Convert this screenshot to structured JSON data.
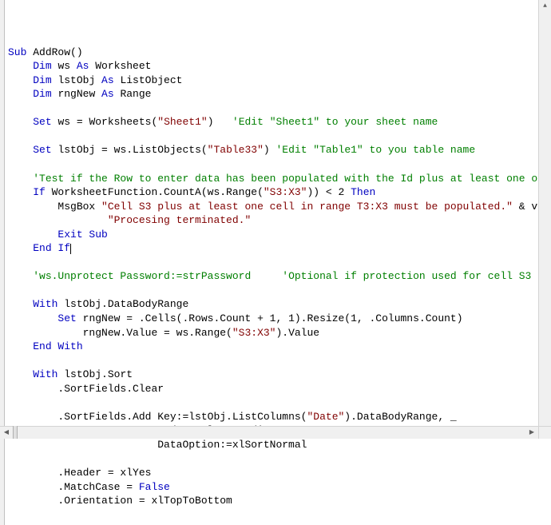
{
  "code": {
    "lines": [
      {
        "indent": 0,
        "segments": [
          [
            "kw",
            "Sub "
          ],
          [
            "id",
            "AddRow()"
          ]
        ]
      },
      {
        "indent": 1,
        "segments": [
          [
            "kw",
            "Dim "
          ],
          [
            "id",
            "ws "
          ],
          [
            "kw",
            "As "
          ],
          [
            "id",
            "Worksheet"
          ]
        ]
      },
      {
        "indent": 1,
        "segments": [
          [
            "kw",
            "Dim "
          ],
          [
            "id",
            "lstObj "
          ],
          [
            "kw",
            "As "
          ],
          [
            "id",
            "ListObject"
          ]
        ]
      },
      {
        "indent": 1,
        "segments": [
          [
            "kw",
            "Dim "
          ],
          [
            "id",
            "rngNew "
          ],
          [
            "kw",
            "As "
          ],
          [
            "id",
            "Range"
          ]
        ]
      },
      {
        "indent": 0,
        "segments": []
      },
      {
        "indent": 1,
        "segments": [
          [
            "kw",
            "Set "
          ],
          [
            "id",
            "ws = Worksheets("
          ],
          [
            "str",
            "\"Sheet1\""
          ],
          [
            "id",
            ")   "
          ],
          [
            "cmt",
            "'Edit \"Sheet1\" to your sheet name"
          ]
        ]
      },
      {
        "indent": 0,
        "segments": []
      },
      {
        "indent": 1,
        "segments": [
          [
            "kw",
            "Set "
          ],
          [
            "id",
            "lstObj = ws.ListObjects("
          ],
          [
            "str",
            "\"Table33\""
          ],
          [
            "id",
            ") "
          ],
          [
            "cmt",
            "'Edit \"Table1\" to you table name"
          ]
        ]
      },
      {
        "indent": 0,
        "segments": []
      },
      {
        "indent": 1,
        "segments": [
          [
            "cmt",
            "'Test if the Row to enter data has been populated with the Id plus at least one o"
          ]
        ]
      },
      {
        "indent": 1,
        "segments": [
          [
            "kw",
            "If "
          ],
          [
            "id",
            "WorksheetFunction.CountA(ws.Range("
          ],
          [
            "str",
            "\"S3:X3\""
          ],
          [
            "id",
            ")) < 2 "
          ],
          [
            "kw",
            "Then"
          ]
        ]
      },
      {
        "indent": 2,
        "segments": [
          [
            "id",
            "MsgBox "
          ],
          [
            "str",
            "\"Cell S3 plus at least one cell in range T3:X3 must be populated.\""
          ],
          [
            "id",
            " & v"
          ]
        ]
      },
      {
        "indent": 4,
        "segments": [
          [
            "str",
            "\"Procesing terminated.\""
          ]
        ]
      },
      {
        "indent": 2,
        "segments": [
          [
            "kw",
            "Exit Sub"
          ]
        ]
      },
      {
        "indent": 1,
        "segments": [
          [
            "kw",
            "End If"
          ]
        ],
        "caret": true
      },
      {
        "indent": 0,
        "segments": []
      },
      {
        "indent": 1,
        "segments": [
          [
            "cmt",
            "'ws.Unprotect Password:=strPassword     'Optional if protection used for cell S3"
          ]
        ]
      },
      {
        "indent": 0,
        "segments": []
      },
      {
        "indent": 1,
        "segments": [
          [
            "kw",
            "With "
          ],
          [
            "id",
            "lstObj.DataBodyRange"
          ]
        ]
      },
      {
        "indent": 2,
        "segments": [
          [
            "kw",
            "Set "
          ],
          [
            "id",
            "rngNew = .Cells(.Rows.Count + 1, 1).Resize(1, .Columns.Count)"
          ]
        ]
      },
      {
        "indent": 3,
        "segments": [
          [
            "id",
            "rngNew.Value = ws.Range("
          ],
          [
            "str",
            "\"S3:X3\""
          ],
          [
            "id",
            ").Value"
          ]
        ]
      },
      {
        "indent": 1,
        "segments": [
          [
            "kw",
            "End With"
          ]
        ]
      },
      {
        "indent": 0,
        "segments": []
      },
      {
        "indent": 1,
        "segments": [
          [
            "kw",
            "With "
          ],
          [
            "id",
            "lstObj.Sort"
          ]
        ]
      },
      {
        "indent": 2,
        "segments": [
          [
            "id",
            ".SortFields.Clear"
          ]
        ]
      },
      {
        "indent": 0,
        "segments": []
      },
      {
        "indent": 2,
        "segments": [
          [
            "id",
            ".SortFields.Add Key:=lstObj.ListColumns("
          ],
          [
            "str",
            "\"Date\""
          ],
          [
            "id",
            ").DataBodyRange, _"
          ]
        ]
      },
      {
        "indent": 6,
        "segments": [
          [
            "id",
            "Order:=xlDescending, _"
          ]
        ]
      },
      {
        "indent": 6,
        "segments": [
          [
            "id",
            "DataOption:=xlSortNormal"
          ]
        ]
      },
      {
        "indent": 0,
        "segments": []
      },
      {
        "indent": 2,
        "segments": [
          [
            "id",
            ".Header = xlYes"
          ]
        ]
      },
      {
        "indent": 2,
        "segments": [
          [
            "id",
            ".MatchCase = "
          ],
          [
            "kw",
            "False"
          ]
        ]
      },
      {
        "indent": 2,
        "segments": [
          [
            "id",
            ".Orientation = xlTopToBottom"
          ]
        ]
      }
    ]
  },
  "scrollbar": {
    "up": "▲",
    "down": "▼",
    "left": "◀",
    "right": "▶"
  }
}
